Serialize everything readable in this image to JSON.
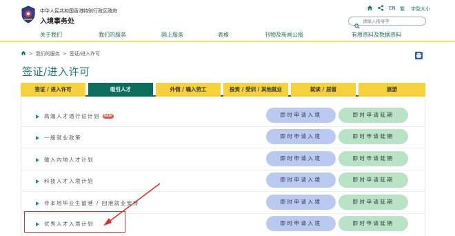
{
  "header": {
    "gov_name": "中华人民共和国香港特别行政区政府",
    "dept_name": "入境事务处",
    "logo_icon": "hksar-emblem-icon"
  },
  "utility": {
    "home_icon": "home-icon",
    "share_icon": "share-icon",
    "lang_label": "EN",
    "trad_label": "繁",
    "font_size_label": "字型大小",
    "search_placeholder": "请输入搜寻字",
    "search_icon": "search-icon"
  },
  "nav": {
    "items": [
      "关于我们",
      "我们的服务",
      "网上服务",
      "表格",
      "刊物及新闻公报",
      "有用资料及数据资料"
    ]
  },
  "breadcrumb": {
    "home_icon": "home-icon",
    "sep": ">",
    "items": [
      "我们的服务",
      "签证/进入许可"
    ]
  },
  "page": {
    "title": "签证/进入许可",
    "print_icon": "print-icon"
  },
  "tabs": {
    "items": [
      "签证 / 进入许可",
      "吸引人才",
      "外佣 / 输入劳工",
      "投资 / 受训 / 其他就业",
      "就读 / 居留",
      "旅游"
    ],
    "active_index": 1
  },
  "schemes": {
    "new_badge": "NEW",
    "entry_label": "即时申请入境",
    "extend_label": "即时申请延期",
    "rows": [
      {
        "label": "高端人才通行证计划"
      },
      {
        "label": "一般就业政策"
      },
      {
        "label": "输入内地人才计划"
      },
      {
        "label": "科技人才入境计划"
      },
      {
        "label": "非本地毕业生留港 / 回港就业安排"
      },
      {
        "label": "优秀人才入境计划"
      }
    ]
  },
  "colors": {
    "brand_green": "#0e6e5e",
    "tab_yellow": "#f5d23c",
    "entry_btn": "#b9c9f0",
    "extend_btn": "#b8e3c4",
    "annotation_red": "#e02b2b"
  }
}
